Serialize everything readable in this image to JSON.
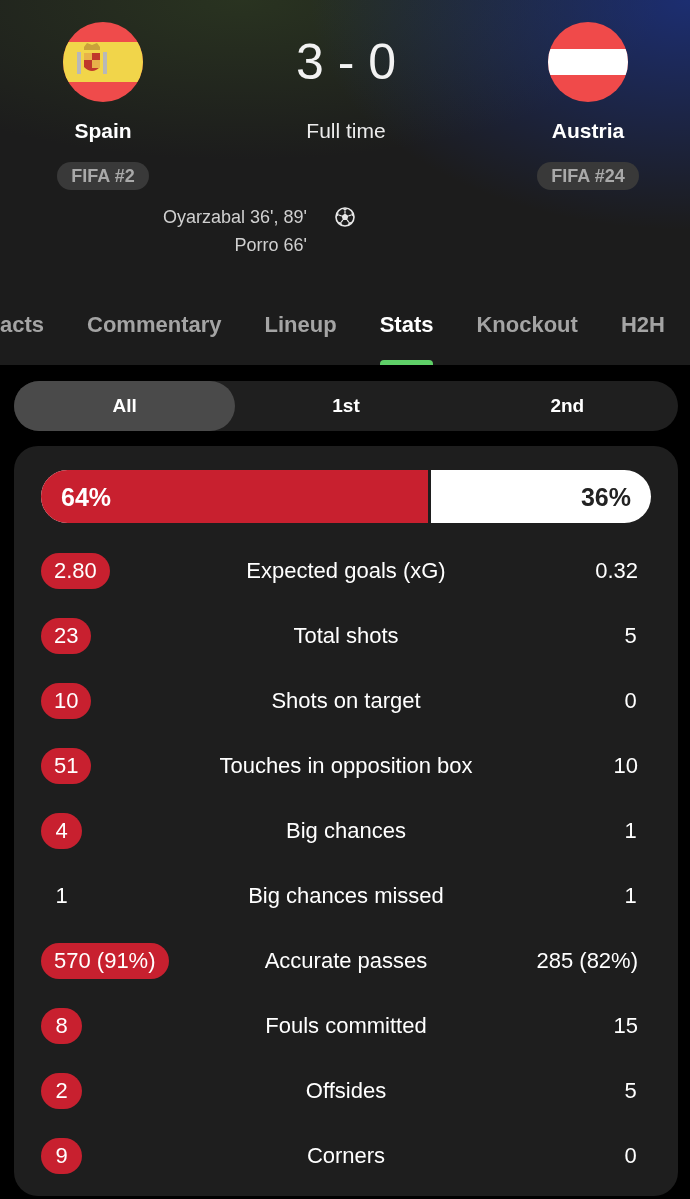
{
  "teams": [
    {
      "name": "Spain",
      "rank": "FIFA #2",
      "color": "#c8202f"
    },
    {
      "name": "Austria",
      "rank": "FIFA #24",
      "color": "#ffffff"
    }
  ],
  "score": "3 - 0",
  "status": "Full time",
  "home_scorers": [
    "Oyarzabal 36', 89'",
    "Porro 66'"
  ],
  "tabs": [
    {
      "label": "acts",
      "selected": false
    },
    {
      "label": "Commentary",
      "selected": false
    },
    {
      "label": "Lineup",
      "selected": false
    },
    {
      "label": "Stats",
      "selected": true
    },
    {
      "label": "Knockout",
      "selected": false
    },
    {
      "label": "H2H",
      "selected": false
    }
  ],
  "periods": [
    {
      "label": "All",
      "selected": true
    },
    {
      "label": "1st",
      "selected": false
    },
    {
      "label": "2nd",
      "selected": false
    }
  ],
  "possession": {
    "home": "64%",
    "away": "36%",
    "level": 0.64
  },
  "stats": [
    {
      "label": "Expected goals (xG)",
      "home": {
        "value": "2.80",
        "highlighted": true
      },
      "away": {
        "value": "0.32",
        "highlighted": false
      }
    },
    {
      "label": "Total shots",
      "home": {
        "value": "23",
        "highlighted": true
      },
      "away": {
        "value": "5",
        "highlighted": false
      }
    },
    {
      "label": "Shots on target",
      "home": {
        "value": "10",
        "highlighted": true
      },
      "away": {
        "value": "0",
        "highlighted": false
      }
    },
    {
      "label": "Touches in opposition box",
      "home": {
        "value": "51",
        "highlighted": true
      },
      "away": {
        "value": "10",
        "highlighted": false
      }
    },
    {
      "label": "Big chances",
      "home": {
        "value": "4",
        "highlighted": true
      },
      "away": {
        "value": "1",
        "highlighted": false
      }
    },
    {
      "label": "Big chances missed",
      "home": {
        "value": "1",
        "highlighted": false
      },
      "away": {
        "value": "1",
        "highlighted": false
      }
    },
    {
      "label": "Accurate passes",
      "home": {
        "value": "570 (91%)",
        "highlighted": true
      },
      "away": {
        "value": "285 (82%)",
        "highlighted": false
      }
    },
    {
      "label": "Fouls committed",
      "home": {
        "value": "8",
        "highlighted": true
      },
      "away": {
        "value": "15",
        "highlighted": false
      }
    },
    {
      "label": "Offsides",
      "home": {
        "value": "2",
        "highlighted": true
      },
      "away": {
        "value": "5",
        "highlighted": false
      }
    },
    {
      "label": "Corners",
      "home": {
        "value": "9",
        "highlighted": true
      },
      "away": {
        "value": "0",
        "highlighted": false
      }
    }
  ]
}
